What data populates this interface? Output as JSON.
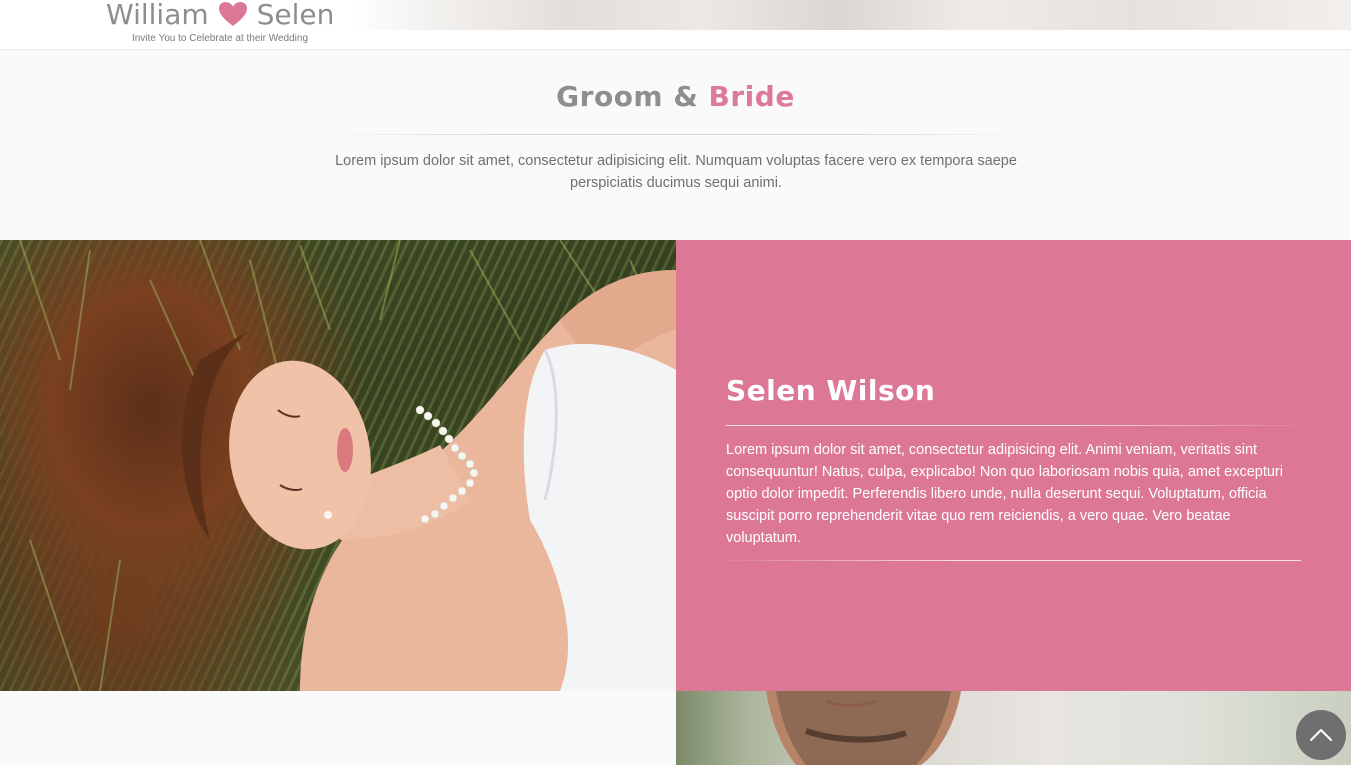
{
  "header": {
    "groom_name": "William",
    "bride_name": "Selen",
    "heart_icon": "heart-icon",
    "tagline": "Invite You to Celebrate at their Wedding"
  },
  "section": {
    "title_part1": "Groom & ",
    "title_accent": "Bride",
    "intro": "Lorem ipsum dolor sit amet, consectetur adipisicing elit. Numquam voluptas facere vero ex tempora saepe perspiciatis ducimus sequi animi."
  },
  "bride": {
    "name": "Selen Wilson",
    "bio": "Lorem ipsum dolor sit amet, consectetur adipisicing elit. Animi veniam, veritatis sint consequuntur! Natus, culpa, explicabo! Non quo laboriosam nobis quia, amet excepturi optio dolor impedit. Perferendis libero unde, nulla deserunt sequi. Voluptatum, officia suscipit porro reprehenderit vitae quo rem reiciendis, a vero quae. Vero beatae voluptatum."
  },
  "scroll_top": {
    "icon": "chevron-up-icon"
  },
  "colors": {
    "accent": "#dc7896",
    "heading": "#8e8e8e",
    "body_text": "#6f6f6f",
    "page_background": "#fafafa",
    "scroll_button": "#6f6f6f"
  }
}
